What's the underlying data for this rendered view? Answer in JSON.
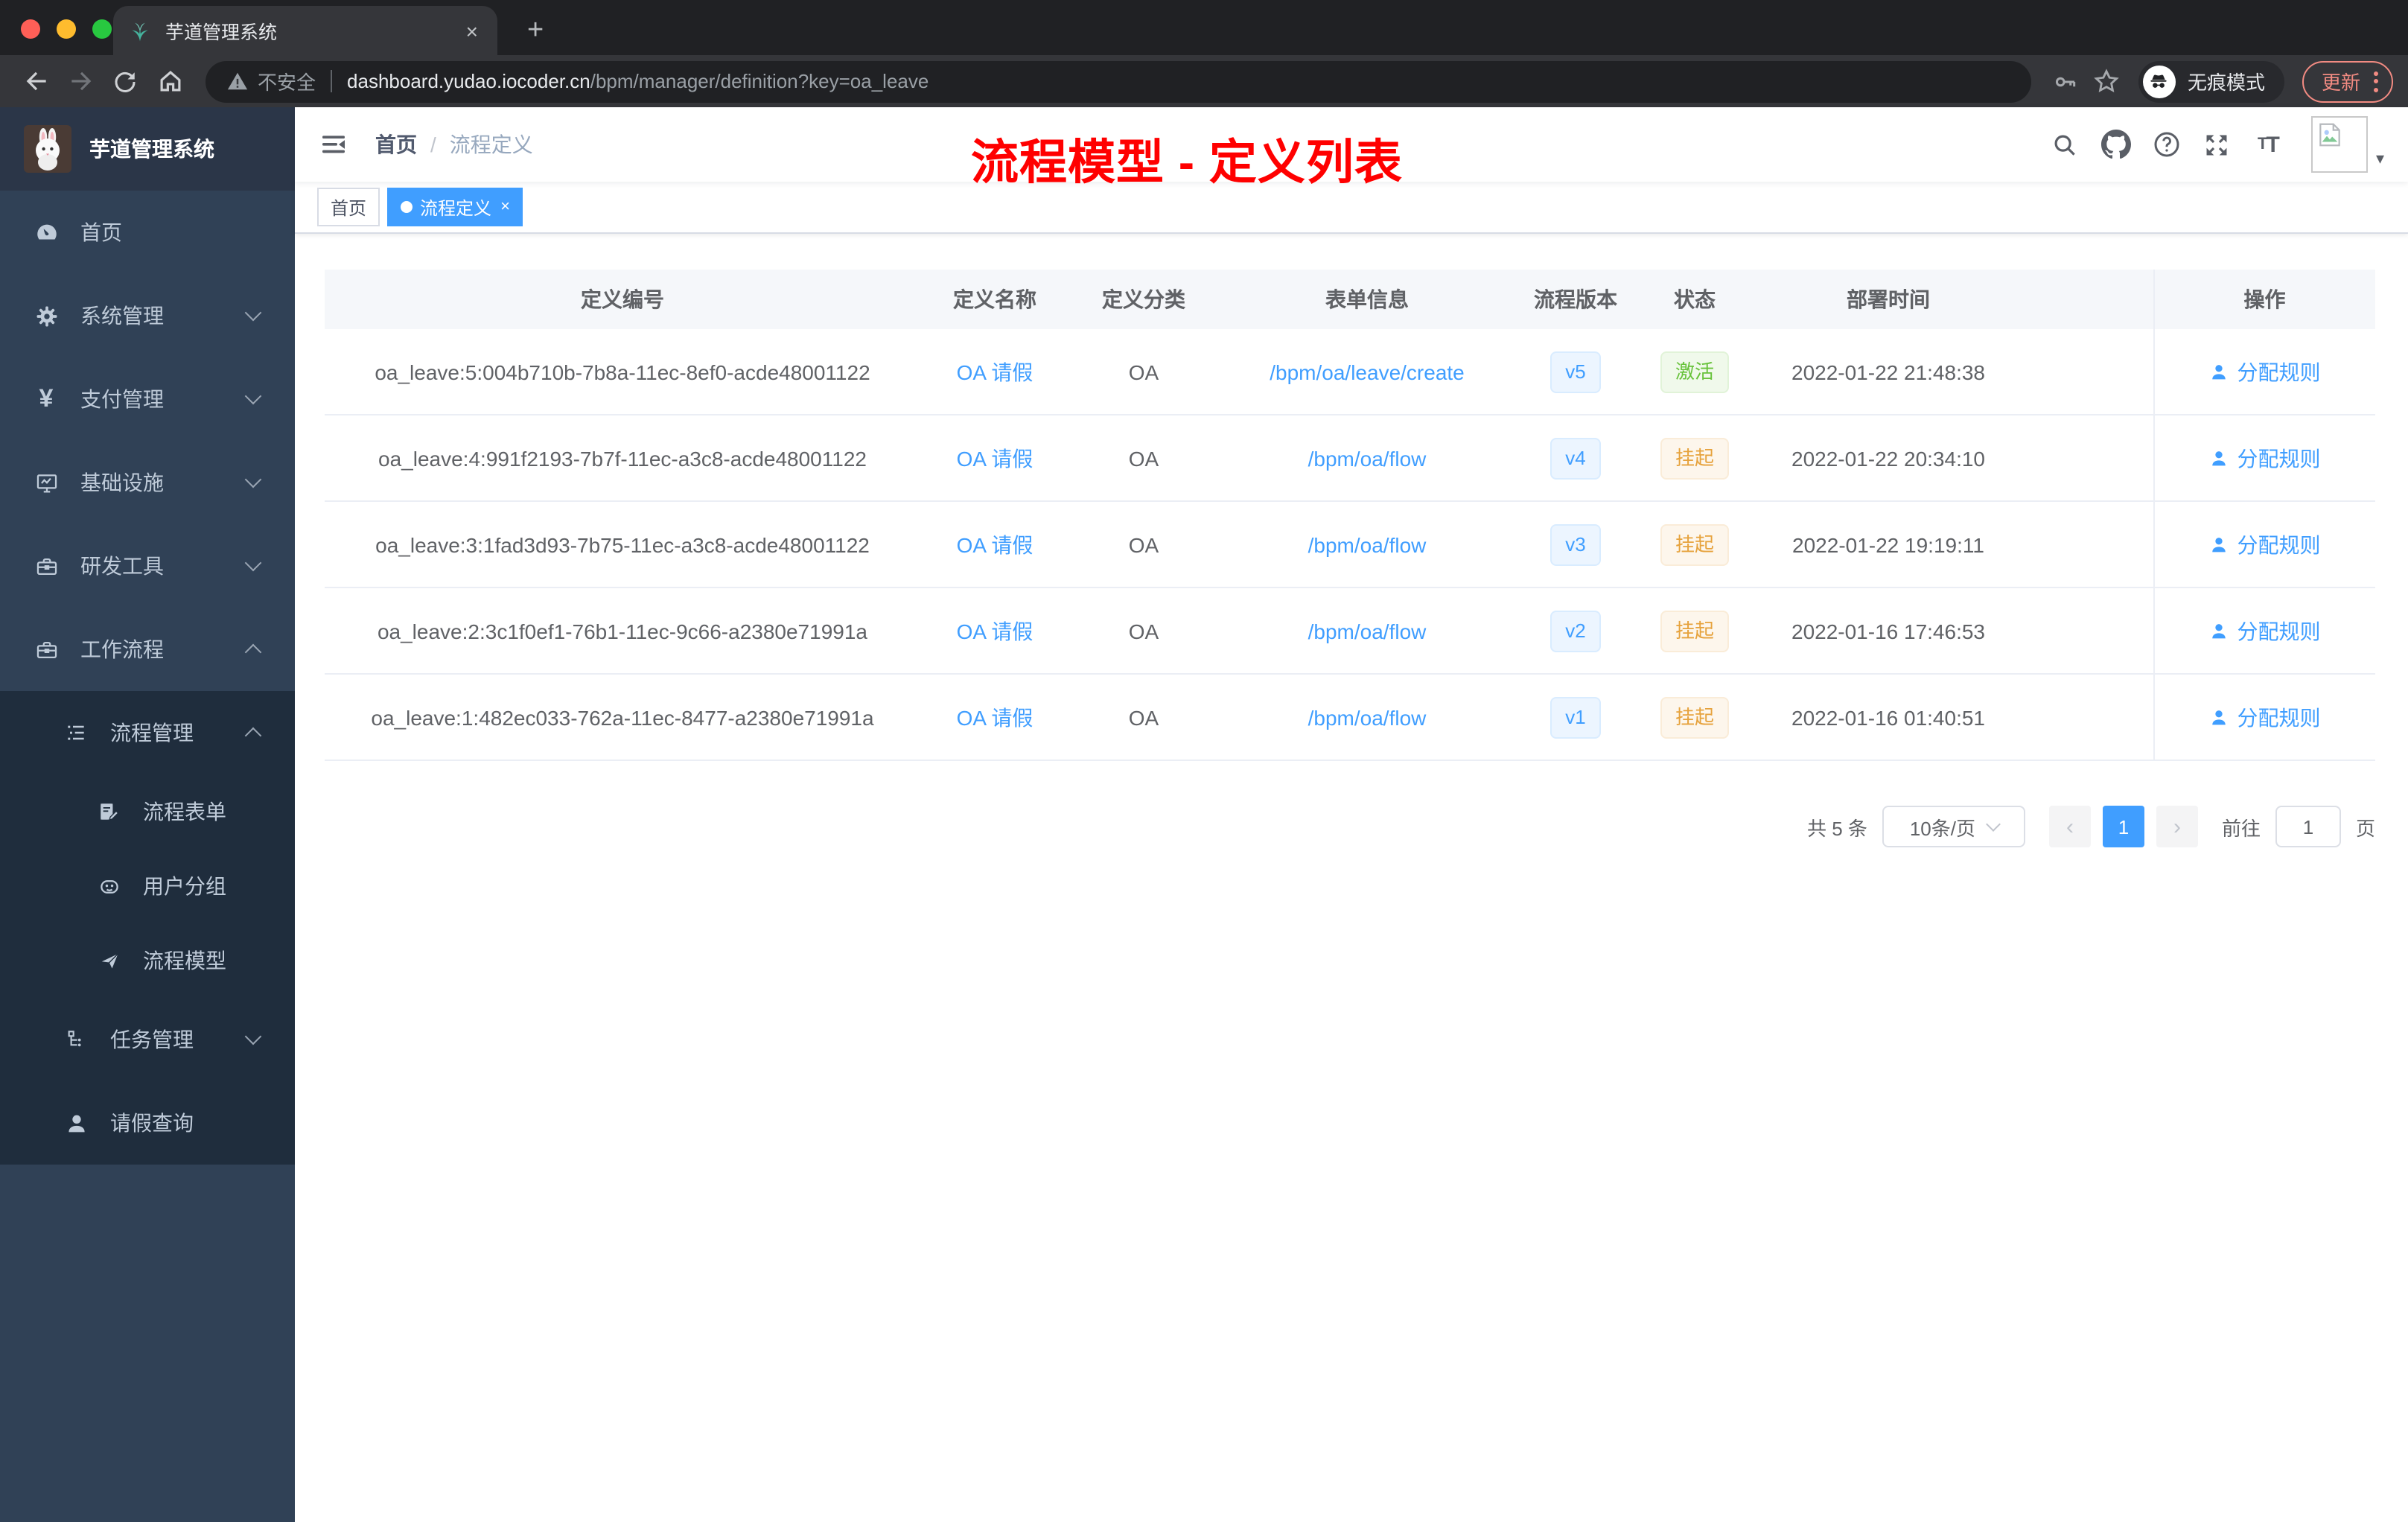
{
  "colors": {
    "accent": "#409EFF",
    "success": "#67C23A",
    "warning": "#E6A23C",
    "annotation_red": "#FF0000",
    "sidebar_bg": "#304156",
    "submenu_bg": "#1F2D3D"
  },
  "browser": {
    "tab_title": "芋道管理系统",
    "security_label": "不安全",
    "url_domain": "dashboard.yudao.iocoder.cn",
    "url_path": "/bpm/manager/definition?key=oa_leave",
    "incognito_label": "无痕模式",
    "update_label": "更新"
  },
  "sidebar": {
    "app_title": "芋道管理系统",
    "items": [
      {
        "label": "首页"
      },
      {
        "label": "系统管理"
      },
      {
        "label": "支付管理"
      },
      {
        "label": "基础设施"
      },
      {
        "label": "研发工具"
      },
      {
        "label": "工作流程"
      },
      {
        "label": "流程管理"
      },
      {
        "label": "流程表单"
      },
      {
        "label": "用户分组"
      },
      {
        "label": "流程模型"
      },
      {
        "label": "任务管理"
      },
      {
        "label": "请假查询"
      }
    ]
  },
  "header": {
    "breadcrumb_home": "首页",
    "breadcrumb_current": "流程定义",
    "annotation": "流程模型 - 定义列表"
  },
  "tags": {
    "home_label": "首页",
    "active_label": "流程定义"
  },
  "table": {
    "headers": {
      "id": "定义编号",
      "name": "定义名称",
      "category": "定义分类",
      "form": "表单信息",
      "version": "流程版本",
      "status": "状态",
      "time": "部署时间",
      "action": "操作"
    },
    "rows": [
      {
        "id": "oa_leave:5:004b710b-7b8a-11ec-8ef0-acde48001122",
        "name": "OA 请假",
        "category": "OA",
        "form": "/bpm/oa/leave/create",
        "version": "v5",
        "status": "激活",
        "time": "2022-01-22 21:48:38",
        "action": "分配规则"
      },
      {
        "id": "oa_leave:4:991f2193-7b7f-11ec-a3c8-acde48001122",
        "name": "OA 请假",
        "category": "OA",
        "form": "/bpm/oa/flow",
        "version": "v4",
        "status": "挂起",
        "time": "2022-01-22 20:34:10",
        "action": "分配规则"
      },
      {
        "id": "oa_leave:3:1fad3d93-7b75-11ec-a3c8-acde48001122",
        "name": "OA 请假",
        "category": "OA",
        "form": "/bpm/oa/flow",
        "version": "v3",
        "status": "挂起",
        "time": "2022-01-22 19:19:11",
        "action": "分配规则"
      },
      {
        "id": "oa_leave:2:3c1f0ef1-76b1-11ec-9c66-a2380e71991a",
        "name": "OA 请假",
        "category": "OA",
        "form": "/bpm/oa/flow",
        "version": "v2",
        "status": "挂起",
        "time": "2022-01-16 17:46:53",
        "action": "分配规则"
      },
      {
        "id": "oa_leave:1:482ec033-762a-11ec-8477-a2380e71991a",
        "name": "OA 请假",
        "category": "OA",
        "form": "/bpm/oa/flow",
        "version": "v1",
        "status": "挂起",
        "time": "2022-01-16 01:40:51",
        "action": "分配规则"
      }
    ]
  },
  "pagination": {
    "total_label": "共 5 条",
    "page_size_label": "10条/页",
    "current_page": "1",
    "goto_label": "前往",
    "goto_value": "1",
    "page_unit": "页"
  }
}
